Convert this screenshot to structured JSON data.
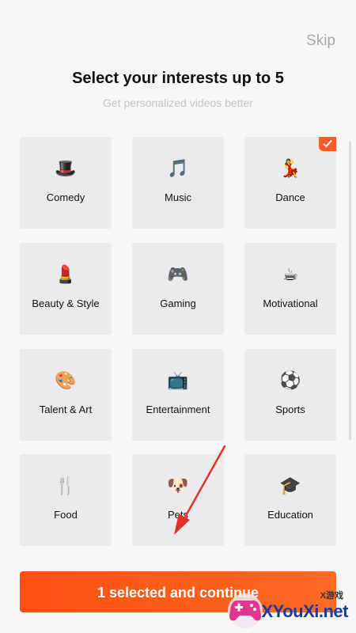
{
  "header": {
    "skip_label": "Skip",
    "title": "Select your interests up to 5",
    "subtitle": "Get personalized videos better"
  },
  "interests": [
    {
      "label": "Comedy",
      "icon": "top-hat-icon",
      "glyph": "🎩",
      "selected": false
    },
    {
      "label": "Music",
      "icon": "musical-note-icon",
      "glyph": "🎵",
      "selected": false
    },
    {
      "label": "Dance",
      "icon": "dancer-icon",
      "glyph": "💃",
      "selected": true
    },
    {
      "label": "Beauty & Style",
      "icon": "lipstick-icon",
      "glyph": "💄",
      "selected": false
    },
    {
      "label": "Gaming",
      "icon": "gamepad-icon",
      "glyph": "🎮",
      "selected": false
    },
    {
      "label": "Motivational",
      "icon": "coffee-cup-icon",
      "glyph": "☕",
      "selected": false
    },
    {
      "label": "Talent & Art",
      "icon": "art-palette-icon",
      "glyph": "🎨",
      "selected": false
    },
    {
      "label": "Entertainment",
      "icon": "television-icon",
      "glyph": "📺",
      "selected": false
    },
    {
      "label": "Sports",
      "icon": "soccer-ball-icon",
      "glyph": "⚽",
      "selected": false
    },
    {
      "label": "Food",
      "icon": "fork-and-knife-icon",
      "glyph": "🍴",
      "selected": false
    },
    {
      "label": "Pets",
      "icon": "dog-face-icon",
      "glyph": "🐶",
      "selected": false
    },
    {
      "label": "Education",
      "icon": "graduation-cap-icon",
      "glyph": "🎓",
      "selected": false
    }
  ],
  "footer": {
    "continue_label": "1 selected and continue"
  },
  "watermark": {
    "sub_text": "X游戏",
    "main_text": "XYouXi.net"
  },
  "colors": {
    "accent": "#ff5c1f",
    "tile_bg": "#ebebed",
    "annotation_arrow": "#e0312b"
  }
}
